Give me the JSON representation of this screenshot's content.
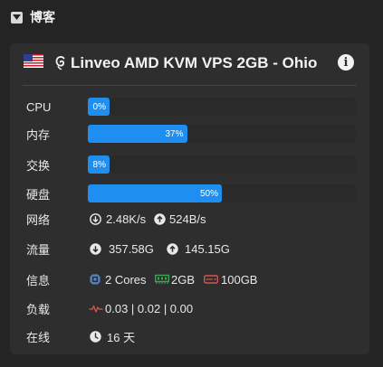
{
  "section": {
    "title": "博客"
  },
  "server": {
    "name": "Linveo AMD KVM VPS 2GB - Ohio",
    "country": "US",
    "os_icon": "debian-icon"
  },
  "colors": {
    "accent": "#1e8ff0",
    "memory_icon": "#3aa655",
    "disk_icon": "#d9534f",
    "cpu_icon": "#5b8fd6",
    "load_icon": "#d9534f"
  },
  "stats": {
    "cpu": {
      "label": "CPU",
      "percent": 0,
      "text": "0%"
    },
    "mem": {
      "label": "内存",
      "percent": 37,
      "text": "37%"
    },
    "swap": {
      "label": "交换",
      "percent": 8,
      "text": "8%"
    },
    "disk": {
      "label": "硬盘",
      "percent": 50,
      "text": "50%"
    }
  },
  "network": {
    "label": "网络",
    "down": "2.48K/s",
    "up": "524B/s"
  },
  "traffic": {
    "label": "流量",
    "down": "357.58G",
    "up": "145.15G"
  },
  "info": {
    "label": "信息",
    "cores": "2 Cores",
    "memory": "2GB",
    "disk": "100GB"
  },
  "load": {
    "label": "负载",
    "value": "0.03 | 0.02 | 0.00"
  },
  "uptime": {
    "label": "在线",
    "value": "16 天"
  }
}
